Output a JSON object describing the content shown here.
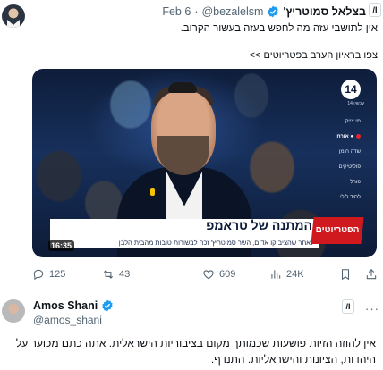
{
  "tweet1": {
    "author_name": "בצלאל סמוטריץ'",
    "handle": "@bezalelsm",
    "separator": "·",
    "time": "Feb 6",
    "text_line1": "אין לתושבי עזה מה לחפש בעזה בעשור הקרוב.",
    "text_line2": "צפו בראיון הערב בפטריוטים >>",
    "media": {
      "channel_logo": "14",
      "channel_caption": "עכשיו 14",
      "menu": [
        "מי צייק",
        "● אורח",
        "שדה חימן",
        "פוליטיקים",
        "פורל",
        "לסיד לילי"
      ],
      "menu_active_index": 1,
      "headline": "המתנה של טראמפ",
      "subline": "לאחר שהציב קו אדום, השר סמוטריץ' זכה לבשורות טובות מהבית הלבן",
      "show_tag": "הפטריוטים",
      "duration": "16:35"
    },
    "actions": {
      "replies": "125",
      "reposts": "43",
      "likes": "609",
      "views": "24K"
    }
  },
  "tweet2": {
    "author_name": "Amos Shani",
    "handle": "@amos_shani",
    "more": "···",
    "text_line1": "אין להוזה הזיות פושעות שכמותך מקום בציבוריות הישראלית. אתה כתם מכוער על",
    "text_line2": "היהדות, הציונות והישראליות. התנדף."
  },
  "badges": {
    "grok_label": "/I"
  },
  "colors": {
    "verified": "#1d9bf0",
    "muted": "#536471",
    "accent_red": "#d0181f"
  }
}
